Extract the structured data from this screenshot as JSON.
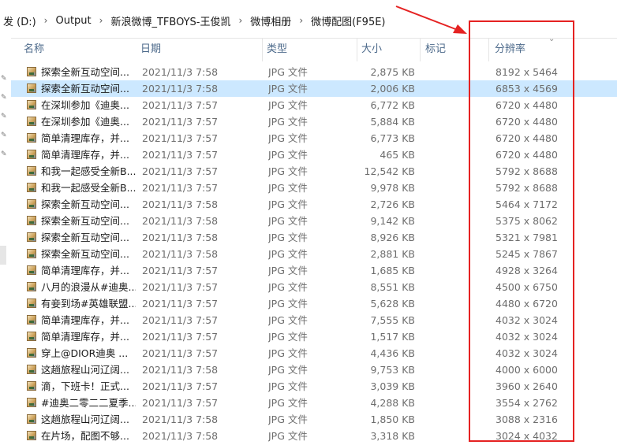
{
  "breadcrumb": [
    "发 (D:)",
    "Output",
    "新浪微博_TFBOYS-王俊凯",
    "微博相册",
    "微博配图(F95E)"
  ],
  "columns": {
    "name": "名称",
    "date": "日期",
    "type": "类型",
    "size": "大小",
    "tag": "标记",
    "resolution": "分辨率"
  },
  "files": [
    {
      "name": "探索全新互动空间...",
      "date": "2021/11/3 7:58",
      "type": "JPG 文件",
      "size": "2,875 KB",
      "res": "8192 x 5464"
    },
    {
      "name": "探索全新互动空间...",
      "date": "2021/11/3 7:58",
      "type": "JPG 文件",
      "size": "2,006 KB",
      "res": "6853 x 4569"
    },
    {
      "name": "在深圳参加《迪奥...",
      "date": "2021/11/3 7:57",
      "type": "JPG 文件",
      "size": "6,772 KB",
      "res": "6720 x 4480"
    },
    {
      "name": "在深圳参加《迪奥...",
      "date": "2021/11/3 7:57",
      "type": "JPG 文件",
      "size": "5,884 KB",
      "res": "6720 x 4480"
    },
    {
      "name": "简单清理库存，并...",
      "date": "2021/11/3 7:57",
      "type": "JPG 文件",
      "size": "6,773 KB",
      "res": "6720 x 4480"
    },
    {
      "name": "简单清理库存，并...",
      "date": "2021/11/3 7:57",
      "type": "JPG 文件",
      "size": "465 KB",
      "res": "6720 x 4480"
    },
    {
      "name": "和我一起感受全新B...",
      "date": "2021/11/3 7:57",
      "type": "JPG 文件",
      "size": "12,542 KB",
      "res": "5792 x 8688"
    },
    {
      "name": "和我一起感受全新B...",
      "date": "2021/11/3 7:57",
      "type": "JPG 文件",
      "size": "9,978 KB",
      "res": "5792 x 8688"
    },
    {
      "name": "探索全新互动空间...",
      "date": "2021/11/3 7:58",
      "type": "JPG 文件",
      "size": "2,726 KB",
      "res": "5464 x 7172"
    },
    {
      "name": "探索全新互动空间...",
      "date": "2021/11/3 7:58",
      "type": "JPG 文件",
      "size": "9,142 KB",
      "res": "5375 x 8062"
    },
    {
      "name": "探索全新互动空间...",
      "date": "2021/11/3 7:58",
      "type": "JPG 文件",
      "size": "8,926 KB",
      "res": "5321 x 7981"
    },
    {
      "name": "探索全新互动空间...",
      "date": "2021/11/3 7:58",
      "type": "JPG 文件",
      "size": "2,881 KB",
      "res": "5245 x 7867"
    },
    {
      "name": "简单清理库存，并...",
      "date": "2021/11/3 7:57",
      "type": "JPG 文件",
      "size": "1,685 KB",
      "res": "4928 x 3264"
    },
    {
      "name": "八月的浪漫从#迪奥...",
      "date": "2021/11/3 7:57",
      "type": "JPG 文件",
      "size": "8,551 KB",
      "res": "4500 x 6750"
    },
    {
      "name": "有妾到场#英雄联盟...",
      "date": "2021/11/3 7:57",
      "type": "JPG 文件",
      "size": "5,628 KB",
      "res": "4480 x 6720"
    },
    {
      "name": "简单清理库存，并...",
      "date": "2021/11/3 7:57",
      "type": "JPG 文件",
      "size": "7,555 KB",
      "res": "4032 x 3024"
    },
    {
      "name": "简单清理库存，并...",
      "date": "2021/11/3 7:57",
      "type": "JPG 文件",
      "size": "1,517 KB",
      "res": "4032 x 3024"
    },
    {
      "name": "穿上@DIOR迪奥 ...",
      "date": "2021/11/3 7:57",
      "type": "JPG 文件",
      "size": "4,436 KB",
      "res": "4032 x 3024"
    },
    {
      "name": "这趟旅程山河辽阔...",
      "date": "2021/11/3 7:58",
      "type": "JPG 文件",
      "size": "9,753 KB",
      "res": "4000 x 6000"
    },
    {
      "name": "滴，下班卡！正式...",
      "date": "2021/11/3 7:57",
      "type": "JPG 文件",
      "size": "3,039 KB",
      "res": "3960 x 2640"
    },
    {
      "name": "#迪奥二零二二夏季...",
      "date": "2021/11/3 7:57",
      "type": "JPG 文件",
      "size": "4,288 KB",
      "res": "3554 x 2762"
    },
    {
      "name": "这趟旅程山河辽阔...",
      "date": "2021/11/3 7:58",
      "type": "JPG 文件",
      "size": "1,850 KB",
      "res": "3088 x 2316"
    },
    {
      "name": "在片场，配图不够...",
      "date": "2021/11/3 7:58",
      "type": "JPG 文件",
      "size": "3,318 KB",
      "res": "3024 x 4032"
    }
  ],
  "colors": {
    "annotation": "#e52222",
    "selected_row": "#cce8ff",
    "header_text": "#4d6a8b"
  },
  "icons": {
    "file": "jpg-image-file-icon",
    "sort": "chevron-down-icon",
    "pin": "pin-icon"
  }
}
